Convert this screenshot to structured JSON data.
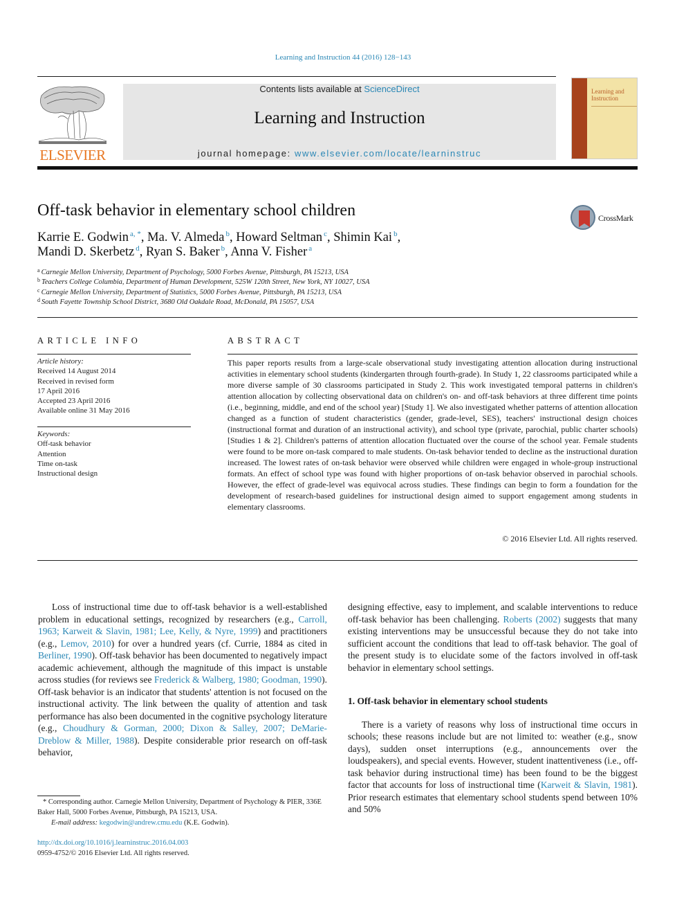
{
  "header": {
    "citation": "Learning and Instruction 44 (2016) 128−143",
    "contents_prefix": "Contents lists available at ",
    "contents_link": "ScienceDirect",
    "journal_name": "Learning and Instruction",
    "homepage_prefix": "journal homepage: ",
    "homepage_link": "www.elsevier.com/locate/learninstruc",
    "publisher_logo_text": "ELSEVIER",
    "cover_title_line1": "Learning and",
    "cover_title_line2": "Instruction",
    "colors": {
      "link": "#2a87b5",
      "elsevier_orange": "#e87722",
      "masthead_bg": "#e6e6e6"
    }
  },
  "article": {
    "title": "Off-task behavior in elementary school children",
    "crossmark_label": "CrossMark",
    "authors": [
      {
        "name": "Karrie E. Godwin",
        "sup": "a, *"
      },
      {
        "name": "Ma. V. Almeda",
        "sup": "b"
      },
      {
        "name": "Howard Seltman",
        "sup": "c"
      },
      {
        "name": "Shimin Kai",
        "sup": "b"
      },
      {
        "name": "Mandi D. Skerbetz",
        "sup": "d"
      },
      {
        "name": "Ryan S. Baker",
        "sup": "b"
      },
      {
        "name": "Anna V. Fisher",
        "sup": "a"
      }
    ],
    "affiliations": [
      {
        "key": "a",
        "text": "Carnegie Mellon University, Department of Psychology, 5000 Forbes Avenue, Pittsburgh, PA 15213, USA"
      },
      {
        "key": "b",
        "text": "Teachers College Columbia, Department of Human Development, 525W 120th Street, New York, NY 10027, USA"
      },
      {
        "key": "c",
        "text": "Carnegie Mellon University, Department of Statistics, 5000 Forbes Avenue, Pittsburgh, PA 15213, USA"
      },
      {
        "key": "d",
        "text": "South Fayette Township School District, 3680 Old Oakdale Road, McDonald, PA 15057, USA"
      }
    ]
  },
  "article_info": {
    "heading": "ARTICLE INFO",
    "history_label": "Article history:",
    "history": [
      "Received 14 August 2014",
      "Received in revised form",
      "17 April 2016",
      "Accepted 23 April 2016",
      "Available online 31 May 2016"
    ],
    "keywords_label": "Keywords:",
    "keywords": [
      "Off-task behavior",
      "Attention",
      "Time on-task",
      "Instructional design"
    ]
  },
  "abstract": {
    "heading": "ABSTRACT",
    "text": "This paper reports results from a large-scale observational study investigating attention allocation during instructional activities in elementary school students (kindergarten through fourth-grade). In Study 1, 22 classrooms participated while a more diverse sample of 30 classrooms participated in Study 2. This work investigated temporal patterns in children's attention allocation by collecting observational data on children's on- and off-task behaviors at three different time points (i.e., beginning, middle, and end of the school year) [Study 1]. We also investigated whether patterns of attention allocation changed as a function of student characteristics (gender, grade-level, SES), teachers' instructional design choices (instructional format and duration of an instructional activity), and school type (private, parochial, public charter schools) [Studies 1 & 2]. Children's patterns of attention allocation fluctuated over the course of the school year. Female students were found to be more on-task compared to male students. On-task behavior tended to decline as the instructional duration increased. The lowest rates of on-task behavior were observed while children were engaged in whole-group instructional formats. An effect of school type was found with higher proportions of on-task behavior observed in parochial schools. However, the effect of grade-level was equivocal across studies. These findings can begin to form a foundation for the development of research-based guidelines for instructional design aimed to support engagement among students in elementary classrooms.",
    "copyright": "© 2016 Elsevier Ltd. All rights reserved."
  },
  "body": {
    "left_p1": [
      {
        "t": "Loss of instructional time due to off-task behavior is a well-established problem in educational settings, recognized by re­searchers (e.g., "
      },
      {
        "t": "Carroll, 1963; Karweit & Slavin, 1981; Lee, Kelly, & Nyre, 1999",
        "link": true
      },
      {
        "t": ") and practitioners (e.g., "
      },
      {
        "t": "Lemov, 2010",
        "link": true
      },
      {
        "t": ") for over a hun­dred years (cf. Currie, 1884 as cited in "
      },
      {
        "t": "Berliner, 1990",
        "link": true
      },
      {
        "t": "). Off-task behavior has been documented to negatively impact academic achievement, although the magnitude of this impact is unstable across studies (for reviews see "
      },
      {
        "t": "Frederick & Walberg, 1980; Goodman, 1990",
        "link": true
      },
      {
        "t": "). Off-task behavior is an indicator that students' attention is not focused on the instructional activity. The link be­tween the quality of attention and task performance has also been documented in the cognitive psychology literature (e.g., "
      },
      {
        "t": "Choudhury & Gorman, 2000; Dixon & Salley, 2007; DeMarie-Dreblow & Miller, 1988",
        "link": true
      },
      {
        "t": "). Despite considerable prior research on off-task behavior,"
      }
    ],
    "right_p1": [
      {
        "t": "designing effective, easy to implement, and scalable interventions to reduce off-task behavior has been challenging. "
      },
      {
        "t": "Roberts (2002)",
        "link": true
      },
      {
        "t": " suggests that many existing interventions may be unsuccessful because they do not take into sufficient account the conditions that lead to off-task behavior. The goal of the present study is to eluci­date some of the factors involved in off-task behavior in elementary school settings."
      }
    ],
    "section_1_heading": "1.  Off-task behavior in elementary school students",
    "right_p2": [
      {
        "t": "There is a variety of reasons why loss of instructional time oc­curs in schools; these reasons include but are not limited to: weather (e.g., snow days), sudden onset interruptions (e.g., an­nouncements over the loudspeakers), and special events. However, student inattentiveness (i.e., off-task behavior during instructional time) has been found to be the biggest factor that accounts for loss of instructional time ("
      },
      {
        "t": "Karweit & Slavin, 1981",
        "link": true
      },
      {
        "t": "). Prior research esti­mates that elementary school students spend between 10% and 50%"
      }
    ]
  },
  "footnotes": {
    "corresponding": "* Corresponding author. Carnegie Mellon University, Department of Psychology & PIER, 336E Baker Hall, 5000 Forbes Avenue, Pittsburgh, PA 15213, USA.",
    "email_label": "E-mail address: ",
    "email": "kegodwin@andrew.cmu.edu",
    "email_suffix": " (K.E. Godwin).",
    "doi": "http://dx.doi.org/10.1016/j.learninstruc.2016.04.003",
    "issn_line": "0959-4752/© 2016 Elsevier Ltd. All rights reserved."
  }
}
